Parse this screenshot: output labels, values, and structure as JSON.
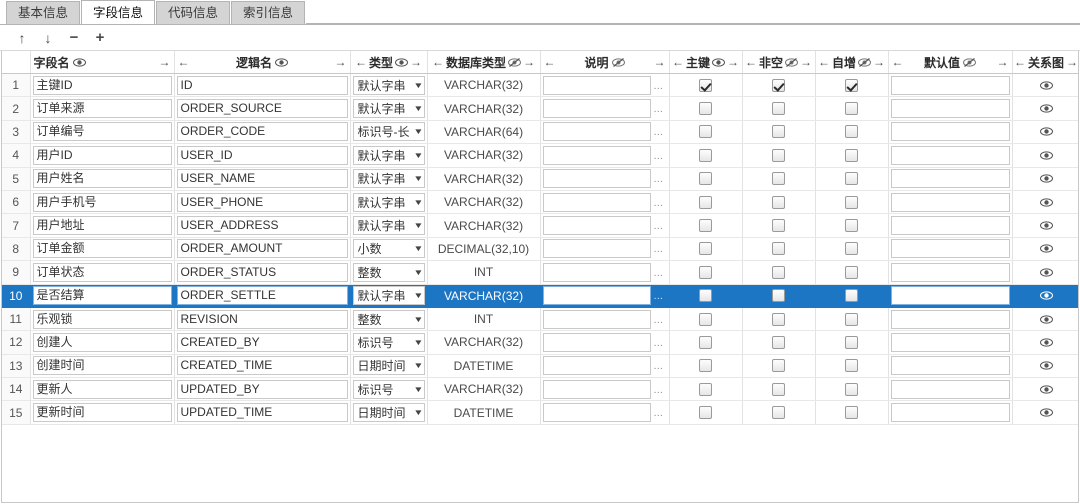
{
  "window": {
    "accent_selection": "#1d76c4",
    "tab_inactive_bg": "#d4d4d4"
  },
  "tabs": [
    {
      "label": "基本信息",
      "active": false
    },
    {
      "label": "字段信息",
      "active": true
    },
    {
      "label": "代码信息",
      "active": false
    },
    {
      "label": "索引信息",
      "active": false
    }
  ],
  "toolbar": {
    "move_up": "↑",
    "move_down": "↓",
    "remove": "−",
    "add": "+"
  },
  "grid": {
    "columns": [
      {
        "key": "num",
        "label": "",
        "left_arrow": false,
        "right_arrow": false,
        "icon": "none"
      },
      {
        "key": "field",
        "label": "字段名",
        "left_arrow": false,
        "right_arrow": true,
        "icon": "eye"
      },
      {
        "key": "logic",
        "label": "逻辑名",
        "left_arrow": true,
        "right_arrow": true,
        "icon": "eye"
      },
      {
        "key": "type",
        "label": "类型",
        "left_arrow": true,
        "right_arrow": true,
        "icon": "eye"
      },
      {
        "key": "dbtype",
        "label": "数据库类型",
        "left_arrow": true,
        "right_arrow": true,
        "icon": "eye-slash"
      },
      {
        "key": "desc",
        "label": "说明",
        "left_arrow": true,
        "right_arrow": true,
        "icon": "eye-slash"
      },
      {
        "key": "pk",
        "label": "主键",
        "left_arrow": true,
        "right_arrow": true,
        "icon": "eye"
      },
      {
        "key": "notnull",
        "label": "非空",
        "left_arrow": true,
        "right_arrow": true,
        "icon": "eye-slash"
      },
      {
        "key": "auto",
        "label": "自增",
        "left_arrow": true,
        "right_arrow": true,
        "icon": "eye-slash"
      },
      {
        "key": "default",
        "label": "默认值",
        "left_arrow": true,
        "right_arrow": true,
        "icon": "eye-slash"
      },
      {
        "key": "diagram",
        "label": "关系图",
        "left_arrow": true,
        "right_arrow": true,
        "icon": "none"
      }
    ],
    "selected_row": 10,
    "rows": [
      {
        "num": "1",
        "field": "主键ID",
        "logic": "ID",
        "type": "默认字串",
        "dbtype": "VARCHAR(32)",
        "desc": "",
        "pk": true,
        "notnull": true,
        "auto": true,
        "default": "",
        "diagram": "eye-icon"
      },
      {
        "num": "2",
        "field": "订单来源",
        "logic": "ORDER_SOURCE",
        "type": "默认字串",
        "dbtype": "VARCHAR(32)",
        "desc": "",
        "pk": false,
        "notnull": false,
        "auto": false,
        "default": "",
        "diagram": "eye-icon"
      },
      {
        "num": "3",
        "field": "订单编号",
        "logic": "ORDER_CODE",
        "type": "标识号-长",
        "dbtype": "VARCHAR(64)",
        "desc": "",
        "pk": false,
        "notnull": false,
        "auto": false,
        "default": "",
        "diagram": "eye-icon"
      },
      {
        "num": "4",
        "field": "用户ID",
        "logic": "USER_ID",
        "type": "默认字串",
        "dbtype": "VARCHAR(32)",
        "desc": "",
        "pk": false,
        "notnull": false,
        "auto": false,
        "default": "",
        "diagram": "eye-icon"
      },
      {
        "num": "5",
        "field": "用户姓名",
        "logic": "USER_NAME",
        "type": "默认字串",
        "dbtype": "VARCHAR(32)",
        "desc": "",
        "pk": false,
        "notnull": false,
        "auto": false,
        "default": "",
        "diagram": "eye-icon"
      },
      {
        "num": "6",
        "field": "用户手机号",
        "logic": "USER_PHONE",
        "type": "默认字串",
        "dbtype": "VARCHAR(32)",
        "desc": "",
        "pk": false,
        "notnull": false,
        "auto": false,
        "default": "",
        "diagram": "eye-icon"
      },
      {
        "num": "7",
        "field": "用户地址",
        "logic": "USER_ADDRESS",
        "type": "默认字串",
        "dbtype": "VARCHAR(32)",
        "desc": "",
        "pk": false,
        "notnull": false,
        "auto": false,
        "default": "",
        "diagram": "eye-icon"
      },
      {
        "num": "8",
        "field": "订单金额",
        "logic": "ORDER_AMOUNT",
        "type": "小数",
        "dbtype": "DECIMAL(32,10)",
        "desc": "",
        "pk": false,
        "notnull": false,
        "auto": false,
        "default": "",
        "diagram": "eye-icon"
      },
      {
        "num": "9",
        "field": "订单状态",
        "logic": "ORDER_STATUS",
        "type": "整数",
        "dbtype": "INT",
        "desc": "",
        "pk": false,
        "notnull": false,
        "auto": false,
        "default": "",
        "diagram": "eye-icon"
      },
      {
        "num": "10",
        "field": "是否结算",
        "logic": "ORDER_SETTLE",
        "type": "默认字串",
        "dbtype": "VARCHAR(32)",
        "desc": "",
        "pk": false,
        "notnull": false,
        "auto": false,
        "default": "",
        "diagram": "eye-icon"
      },
      {
        "num": "11",
        "field": "乐观锁",
        "logic": "REVISION",
        "type": "整数",
        "dbtype": "INT",
        "desc": "",
        "pk": false,
        "notnull": false,
        "auto": false,
        "default": "",
        "diagram": "eye-icon"
      },
      {
        "num": "12",
        "field": "创建人",
        "logic": "CREATED_BY",
        "type": "标识号",
        "dbtype": "VARCHAR(32)",
        "desc": "",
        "pk": false,
        "notnull": false,
        "auto": false,
        "default": "",
        "diagram": "eye-icon"
      },
      {
        "num": "13",
        "field": "创建时间",
        "logic": "CREATED_TIME",
        "type": "日期时间",
        "dbtype": "DATETIME",
        "desc": "",
        "pk": false,
        "notnull": false,
        "auto": false,
        "default": "",
        "diagram": "eye-icon"
      },
      {
        "num": "14",
        "field": "更新人",
        "logic": "UPDATED_BY",
        "type": "标识号",
        "dbtype": "VARCHAR(32)",
        "desc": "",
        "pk": false,
        "notnull": false,
        "auto": false,
        "default": "",
        "diagram": "eye-icon"
      },
      {
        "num": "15",
        "field": "更新时间",
        "logic": "UPDATED_TIME",
        "type": "日期时间",
        "dbtype": "DATETIME",
        "desc": "",
        "pk": false,
        "notnull": false,
        "auto": false,
        "default": "",
        "diagram": "eye-icon"
      }
    ]
  }
}
